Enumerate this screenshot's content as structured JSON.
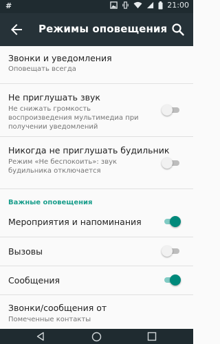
{
  "status_bar": {
    "left_symbol": "#",
    "time": "21:00",
    "icons": [
      "image-icon",
      "vibrate-icon",
      "wifi-icon",
      "signal-icon",
      "battery-icon"
    ]
  },
  "appbar": {
    "title": "Режимы оповещения",
    "back_icon": "arrow-back-icon",
    "search_icon": "search-icon"
  },
  "settings": {
    "calls_notifications": {
      "title": "Звонки и уведомления",
      "subtitle": "Оповещать всегда"
    },
    "dnd_sound": {
      "title": "Не приглушать звук",
      "subtitle_lines": [
        "Не снижать громкость",
        "воспроизведения мультимедиа при",
        "получении уведомлений"
      ],
      "enabled": false
    },
    "never_mute_alarm": {
      "title": "Никогда не приглушать будильник",
      "subtitle_lines": [
        "Режим «Не беспокоить»: звук",
        "будильника отключается"
      ],
      "enabled": false
    },
    "important_section": "Важные оповещения",
    "events_reminders": {
      "title": "Мероприятия и напоминания",
      "enabled": true
    },
    "calls": {
      "title": "Вызовы",
      "enabled": false
    },
    "messages": {
      "title": "Сообщения",
      "enabled": true
    },
    "calls_messages_from": {
      "title": "Звонки/сообщения от",
      "subtitle": "Помеченные контакты"
    }
  },
  "colors": {
    "accent": "#00897b",
    "section": "#1a9e8c",
    "appbar": "#263238",
    "statusbar": "#1f2b30"
  },
  "navbar": {
    "icons": [
      "back-triangle-icon",
      "home-circle-icon",
      "recents-square-icon"
    ]
  }
}
